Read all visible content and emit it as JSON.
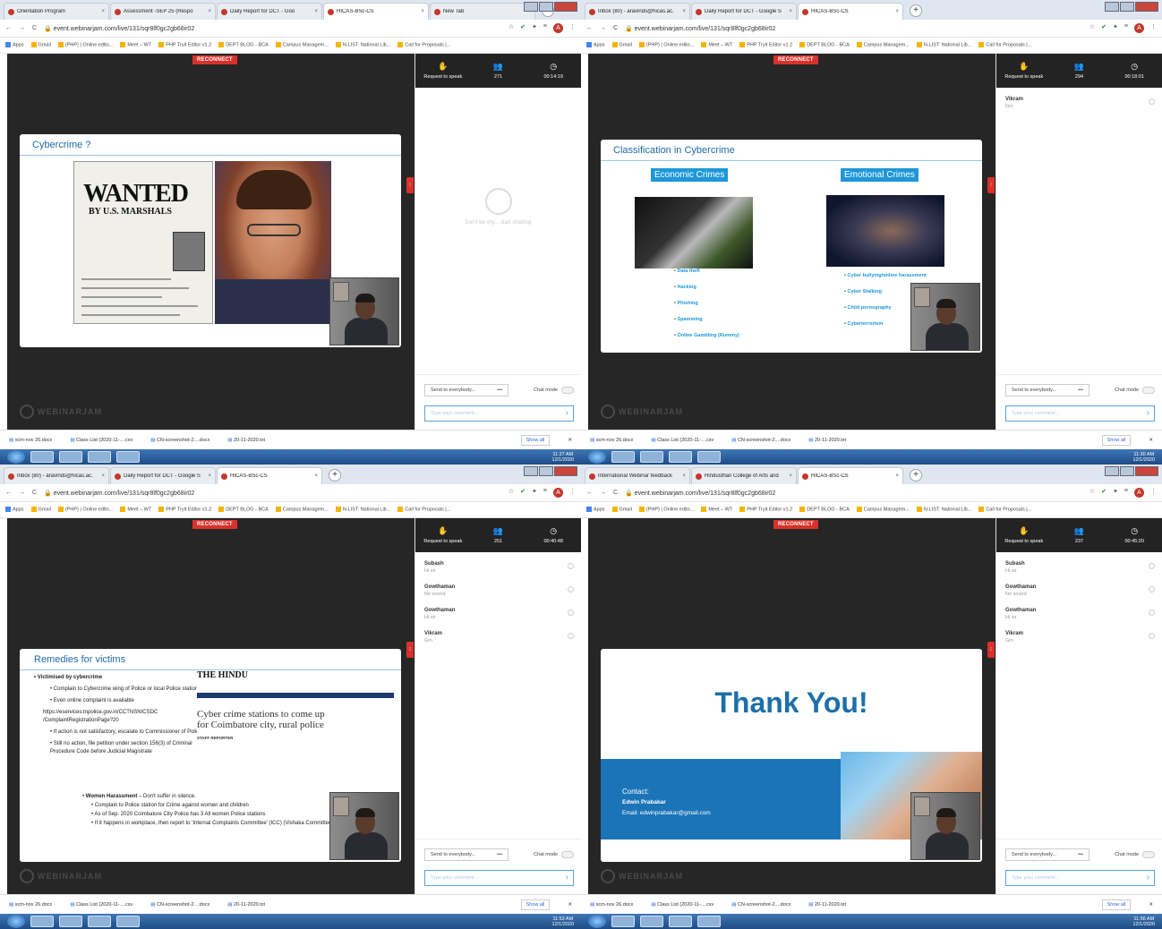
{
  "quadrants": [
    {
      "tabs": [
        "Orientation Program",
        "Assessment -SEP 25 (Respo",
        "Daily Report for DCT - Goo",
        "HICAS-BSc-CS",
        "New Tab"
      ],
      "active_tab": 3,
      "url": "event.webinarjam.com/live/131/sqr8lf0gc2gb68ir02",
      "time": "11:27 AM",
      "date": "12/1/2020",
      "participants": "271",
      "elapsed": "00:14:19",
      "slide_title": "Cybercrime ?"
    },
    {
      "tabs": [
        "Inbox (80) - aravinds@hicas.ac.",
        "Daily Report for DCT - Google S",
        "HICAS-BSc-CS"
      ],
      "active_tab": 2,
      "url": "event.webinarjam.com/live/131/sqr8lf0gc2gb68ir02",
      "time": "11:30 AM",
      "date": "12/1/2020",
      "participants": "294",
      "elapsed": "00:18:01",
      "slide_title": "Classification in Cybercrime",
      "left_heading": "Economic Crimes",
      "right_heading": "Emotional Crimes",
      "left_items": [
        "Data theft",
        "Hacking",
        "Phishing",
        "Spamming",
        "Online Gambling (Rummy)"
      ],
      "right_items": [
        "Cyber bullying/online harassment",
        "Cyber Stalking",
        "Child pornography",
        "Cyberterrorism"
      ]
    },
    {
      "tabs": [
        "Inbox (80) - aravinds@hicas.ac.",
        "Daily Report for DCT - Google S",
        "HICAS-BSc-CS"
      ],
      "active_tab": 2,
      "url": "event.webinarjam.com/live/131/sqr8lf0gc2gb68ir02",
      "time": "11:53 AM",
      "date": "12/1/2020",
      "participants": "251",
      "elapsed": "00:40:48",
      "slide_title": "Remedies for victims",
      "victims_head": "Victimised by cybercrime",
      "victims_items": [
        "Complain to Cybercrime wing of Police or local Police station.",
        "Even online complaint is available",
        "https://eservices.tnpolice.gov.in/CCTNSNICSDC /ComplaintRegistrationPage?20",
        "If action is not satisfactory, escalate to Commissioner of Police",
        "Still no action, file petition under section 156(3) of Criminal Procedure Code before Judicial Magistrate"
      ],
      "news_mast": "THE HINDU",
      "news_head": "Cyber crime stations to come up for Coimbatore city, rural police",
      "news_reporter": "STAFF REPORTER",
      "women_head": "Women Harassment",
      "women_suffix": " – Don't suffer in silence.",
      "women_items": [
        "Complain to Police station for Crime against women and children",
        "As of Sep. 2020 Coimbatore City Police has 3 All women Police stations",
        "If it happens in workplace, then report to 'Internal Complaints Committee' (ICC) (Vishaka Committee)"
      ]
    },
    {
      "tabs": [
        "International Webinar feedback",
        "Hindusthan College of Arts and",
        "HICAS-BSc-CS"
      ],
      "active_tab": 2,
      "url": "event.webinarjam.com/live/131/sqr8lf0gc2gb68ir02",
      "time": "11:56 AM",
      "date": "12/1/2020",
      "participants": "237",
      "elapsed": "00:45:20",
      "thank_you": "Thank You!",
      "contact_label": "Contact:",
      "contact_name": "Edwin Prabakar",
      "contact_email": "Email: edwinprabakar@gmail.com"
    }
  ],
  "chat_q1": [
    {
      "name": "Vikram",
      "text": "Gm"
    }
  ],
  "chat_q2": [
    {
      "name": "Subash",
      "text": "Hi sir"
    },
    {
      "name": "Gowthaman",
      "text": "No sound"
    },
    {
      "name": "Gowthaman",
      "text": "Hi sir"
    },
    {
      "name": "Vikram",
      "text": "Gm"
    }
  ],
  "common": {
    "reconnect": "RECONNECT",
    "request_to_speak": "Request to speak",
    "empty_chat": "Don't be shy... start chatting",
    "send_to": "Send to everybody...",
    "chat_mode": "Chat mode",
    "comment_placeholder": "Type your comment...",
    "logo": "WEBINARJAM",
    "apps": "Apps",
    "bookmarks": [
      "Gmail",
      "(PHP) | Online edito...",
      "Meet – WT",
      "PHP Tryit Editor v1.2",
      "DEPT BLOG - BCA",
      "Campus Managem...",
      "N-LIST: National Lib...",
      "Call for Proposals |..."
    ],
    "downloads": [
      "scm-nov 26.docx",
      "Class List (2020-11-....csv",
      "CN-screenshot-2....docx",
      "20-11-2020.txt"
    ],
    "show_all": "Show all"
  }
}
